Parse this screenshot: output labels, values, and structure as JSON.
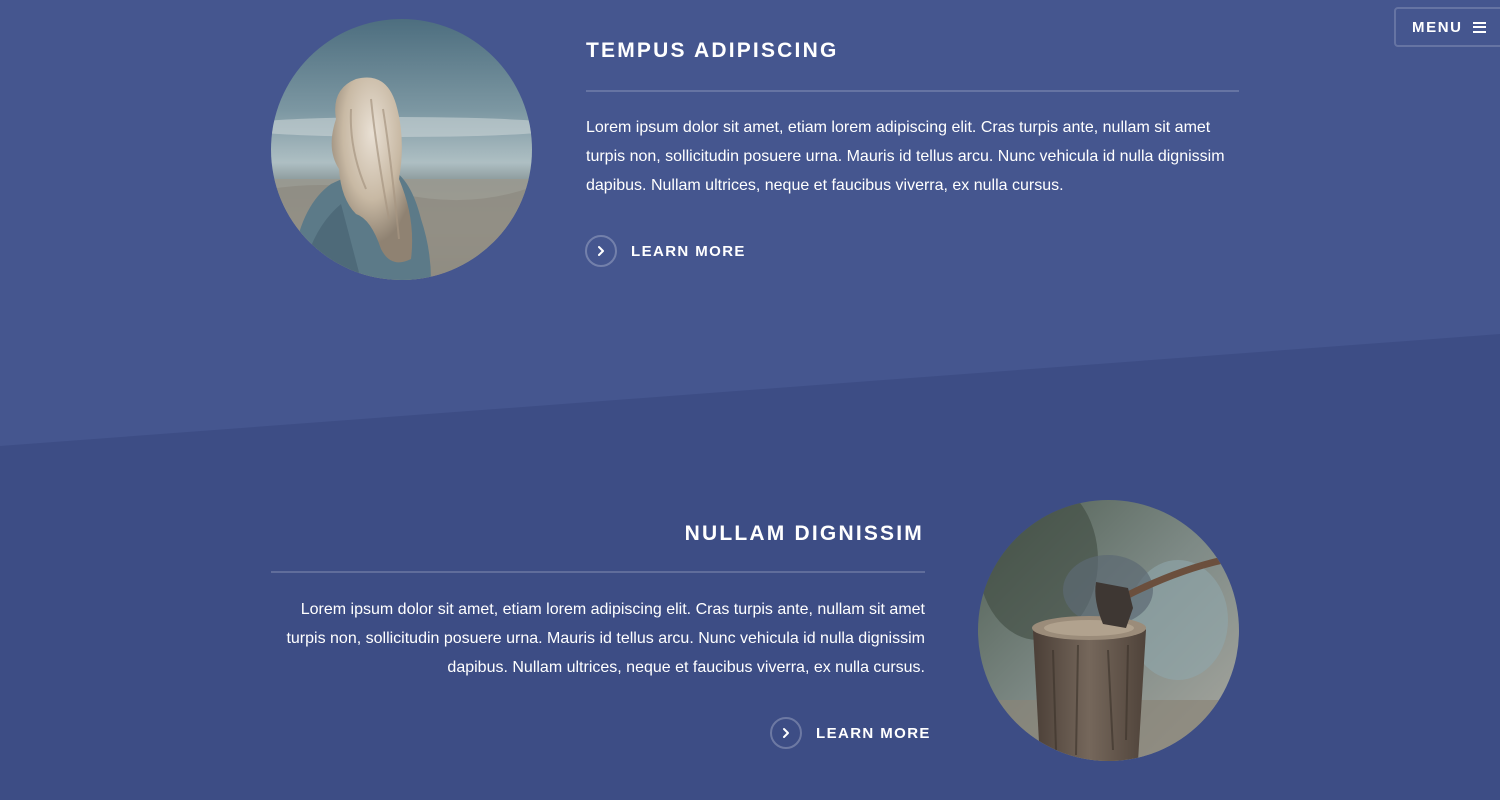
{
  "menu": {
    "label": "MENU",
    "icon": "hamburger-icon"
  },
  "features": [
    {
      "title": "TEMPUS ADIPISCING",
      "body": "Lorem ipsum dolor sit amet, etiam lorem adipiscing elit. Cras turpis ante, nullam sit amet turpis non, sollicitudin posuere urna. Mauris id tellus arcu. Nunc vehicula id nulla dignissim dapibus. Nullam ultrices, neque et faucibus viverra, ex nulla cursus.",
      "link_label": "LEARN MORE",
      "link_icon": "chevron-right-icon",
      "image": "woman-with-long-hair-facing-landscape"
    },
    {
      "title": "NULLAM DIGNISSIM",
      "body": "Lorem ipsum dolor sit amet, etiam lorem adipiscing elit. Cras turpis ante, nullam sit amet turpis non, sollicitudin posuere urna. Mauris id tellus arcu. Nunc vehicula id nulla dignissim dapibus. Nullam ultrices, neque et faucibus viverra, ex nulla cursus.",
      "link_label": "LEARN MORE",
      "link_icon": "chevron-right-icon",
      "image": "axe-in-tree-stump"
    }
  ],
  "colors": {
    "upper_background": "#45568f",
    "lower_background": "#3d4d85",
    "text": "#ffffff"
  }
}
